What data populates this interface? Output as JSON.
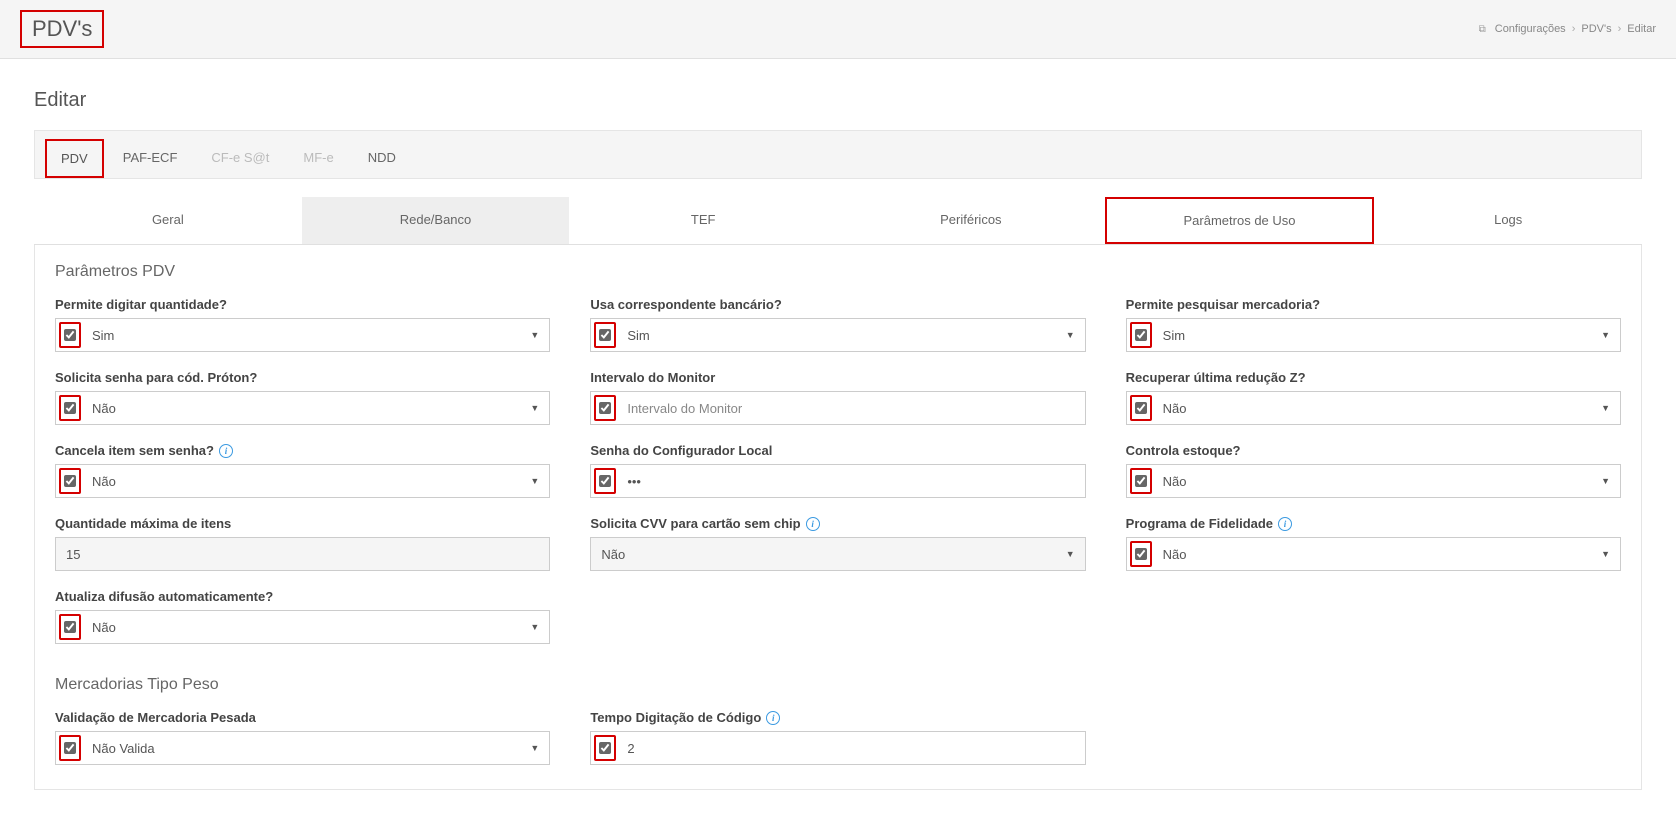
{
  "header": {
    "page_title": "PDV's",
    "breadcrumb": {
      "root": "Configurações",
      "level1": "PDV's",
      "leaf": "Editar"
    }
  },
  "subtitle": "Editar",
  "top_tabs": [
    {
      "label": "PDV",
      "state": "active"
    },
    {
      "label": "PAF-ECF",
      "state": "normal"
    },
    {
      "label": "CF-e S@t",
      "state": "disabled"
    },
    {
      "label": "MF-e",
      "state": "disabled"
    },
    {
      "label": "NDD",
      "state": "normal"
    }
  ],
  "sub_tabs": [
    {
      "label": "Geral",
      "state": "normal"
    },
    {
      "label": "Rede/Banco",
      "state": "shaded"
    },
    {
      "label": "TEF",
      "state": "normal"
    },
    {
      "label": "Periféricos",
      "state": "normal"
    },
    {
      "label": "Parâmetros de Uso",
      "state": "highlighted"
    },
    {
      "label": "Logs",
      "state": "normal"
    }
  ],
  "section1": {
    "heading": "Parâmetros PDV",
    "fields": {
      "permite_digitar_quantidade": {
        "label": "Permite digitar quantidade?",
        "value": "Sim"
      },
      "usa_correspondente_bancario": {
        "label": "Usa correspondente bancário?",
        "value": "Sim"
      },
      "permite_pesquisar_mercadoria": {
        "label": "Permite pesquisar mercadoria?",
        "value": "Sim"
      },
      "solicita_senha_cod_proton": {
        "label": "Solicita senha para cód. Próton?",
        "value": "Não"
      },
      "intervalo_monitor": {
        "label": "Intervalo do Monitor",
        "placeholder": "Intervalo do Monitor",
        "value": ""
      },
      "recuperar_ultima_reducao_z": {
        "label": "Recuperar última redução Z?",
        "value": "Não"
      },
      "cancela_item_sem_senha": {
        "label": "Cancela item sem senha?",
        "value": "Não",
        "info": true
      },
      "senha_configurador_local": {
        "label": "Senha do Configurador Local",
        "value": "•••"
      },
      "controla_estoque": {
        "label": "Controla estoque?",
        "value": "Não"
      },
      "quantidade_maxima_itens": {
        "label": "Quantidade máxima de itens",
        "value": "15"
      },
      "solicita_cvv": {
        "label": "Solicita CVV para cartão sem chip",
        "value": "Não",
        "info": true
      },
      "programa_fidelidade": {
        "label": "Programa de Fidelidade",
        "value": "Não",
        "info": true
      },
      "atualiza_difusao": {
        "label": "Atualiza difusão automaticamente?",
        "value": "Não"
      }
    }
  },
  "section2": {
    "heading": "Mercadorias Tipo Peso",
    "fields": {
      "validacao_mercadoria_pesada": {
        "label": "Validação de Mercadoria Pesada",
        "value": "Não Valida"
      },
      "tempo_digitacao_codigo": {
        "label": "Tempo Digitação de Código",
        "value": "2",
        "info": true
      }
    }
  }
}
